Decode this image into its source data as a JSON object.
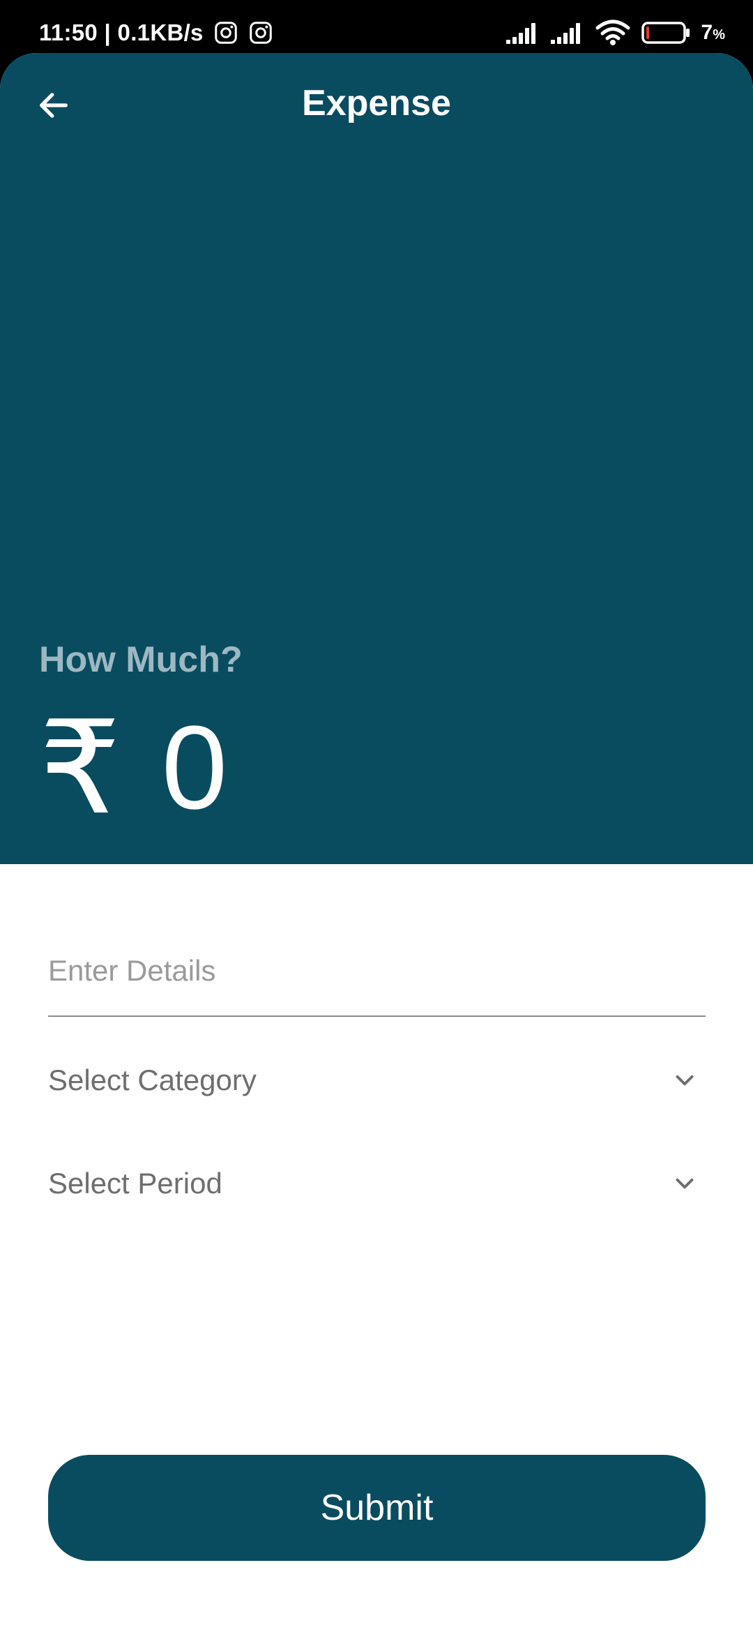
{
  "status_bar": {
    "time_speed": "11:50 | 0.1KB/s",
    "notification_icons": [
      "instagram-icon",
      "instagram-icon"
    ],
    "status_icons": [
      "signal-icon",
      "signal-icon",
      "wifi-icon",
      "battery-icon"
    ],
    "battery_percent": "7",
    "battery_unit": "%",
    "battery_level": 0.07,
    "battery_low_color": "#e53935"
  },
  "header": {
    "back_icon": "arrow-left-icon",
    "title": "Expense",
    "background_color": "#094c60"
  },
  "amount": {
    "label": "How Much?",
    "currency_symbol": "₹",
    "value": "0"
  },
  "form": {
    "details_placeholder": "Enter Details",
    "details_value": "",
    "category_label": "Select Category",
    "period_label": "Select Period",
    "dropdown_icon": "chevron-down-icon"
  },
  "submit": {
    "label": "Submit",
    "color": "#094c60"
  }
}
